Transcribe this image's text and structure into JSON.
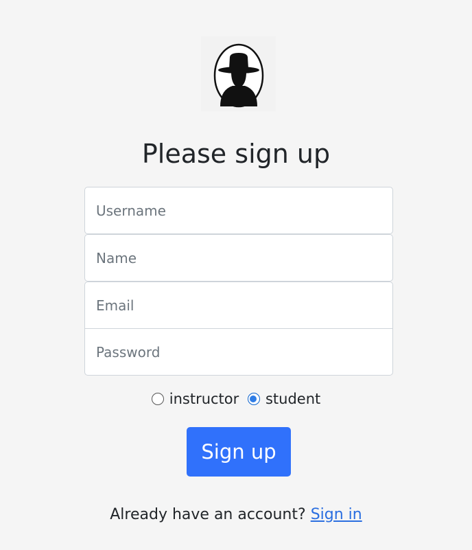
{
  "logo": {
    "icon": "spy-silhouette-icon"
  },
  "title": "Please sign up",
  "form": {
    "username": {
      "placeholder": "Username",
      "value": ""
    },
    "name": {
      "placeholder": "Name",
      "value": ""
    },
    "email": {
      "placeholder": "Email",
      "value": ""
    },
    "password": {
      "placeholder": "Password",
      "value": ""
    }
  },
  "roles": {
    "instructor_label": "instructor",
    "student_label": "student",
    "selected": "student"
  },
  "signup_button": "Sign up",
  "footer": {
    "prompt": "Already have an account?",
    "signin_link": "Sign in"
  },
  "colors": {
    "background": "#f5f5f5",
    "primary": "#3071fb",
    "link": "#2a6ee0"
  }
}
